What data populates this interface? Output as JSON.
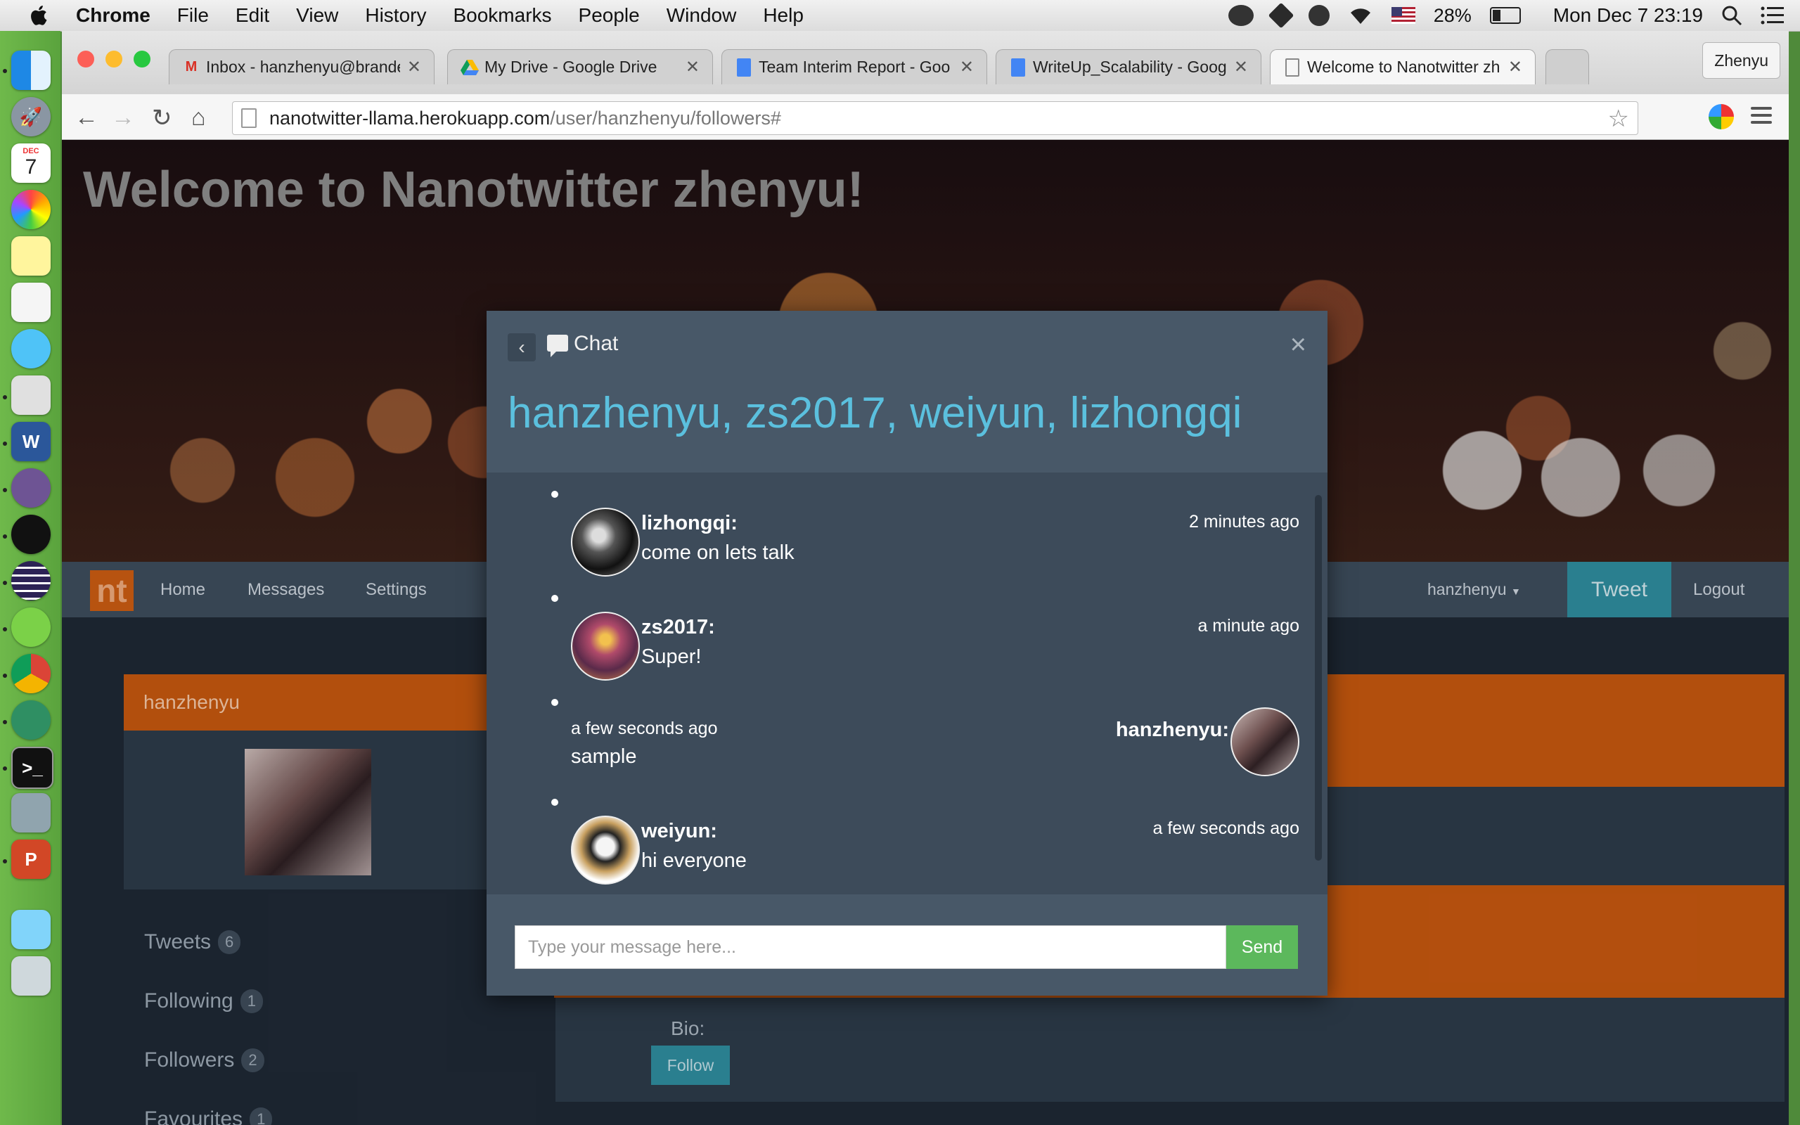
{
  "menubar": {
    "app_name": "Chrome",
    "items": [
      "File",
      "Edit",
      "View",
      "History",
      "Bookmarks",
      "People",
      "Window",
      "Help"
    ],
    "battery": "28%",
    "clock": "Mon Dec 7  23:19"
  },
  "dock": {
    "calendar_month": "DEC",
    "calendar_day": "7"
  },
  "browser": {
    "tabs": [
      {
        "title": "Inbox - hanzhenyu@brande",
        "icon": "gmail-icon"
      },
      {
        "title": "My Drive - Google Drive",
        "icon": "google-drive-icon"
      },
      {
        "title": "Team Interim Report - Goo",
        "icon": "google-docs-icon"
      },
      {
        "title": "WriteUp_Scalability - Goog",
        "icon": "google-docs-icon"
      },
      {
        "title": "Welcome to Nanotwitter zh",
        "icon": "page-icon"
      }
    ],
    "profile_name": "Zhenyu",
    "url_host": "nanotwitter-llama.herokuapp.com",
    "url_path": "/user/hanzhenyu/followers#"
  },
  "page": {
    "hero_title": "Welcome to Nanotwitter zhenyu!",
    "nav": {
      "brand": "nt",
      "links": [
        "Home",
        "Messages",
        "Settings"
      ],
      "user_menu": "hanzhenyu",
      "tweet_button": "Tweet",
      "logout": "Logout"
    },
    "profile": {
      "username": "hanzhenyu",
      "stats": [
        {
          "label": "Tweets",
          "count": "6"
        },
        {
          "label": "Following",
          "count": "1"
        },
        {
          "label": "Followers",
          "count": "2"
        },
        {
          "label": "Favourites",
          "count": "1"
        }
      ]
    },
    "follower_card": {
      "bio_label": "Bio:",
      "follow_button": "Follow"
    }
  },
  "chat": {
    "title": "Chat",
    "close": "×",
    "participants": "hanzhenyu, zs2017, weiyun, lizhongqi",
    "messages": [
      {
        "author": "lizhongqi:",
        "text": "come on lets talk",
        "time": "2 minutes ago",
        "side": "left"
      },
      {
        "author": "zs2017:",
        "text": "Super!",
        "time": "a minute ago",
        "side": "left"
      },
      {
        "author": "hanzhenyu:",
        "text": "sample",
        "time": "a few seconds ago",
        "side": "right"
      },
      {
        "author": "weiyun:",
        "text": "hi everyone",
        "time": "a few seconds ago",
        "side": "left"
      }
    ],
    "input_placeholder": "Type your message here...",
    "send_label": "Send"
  }
}
